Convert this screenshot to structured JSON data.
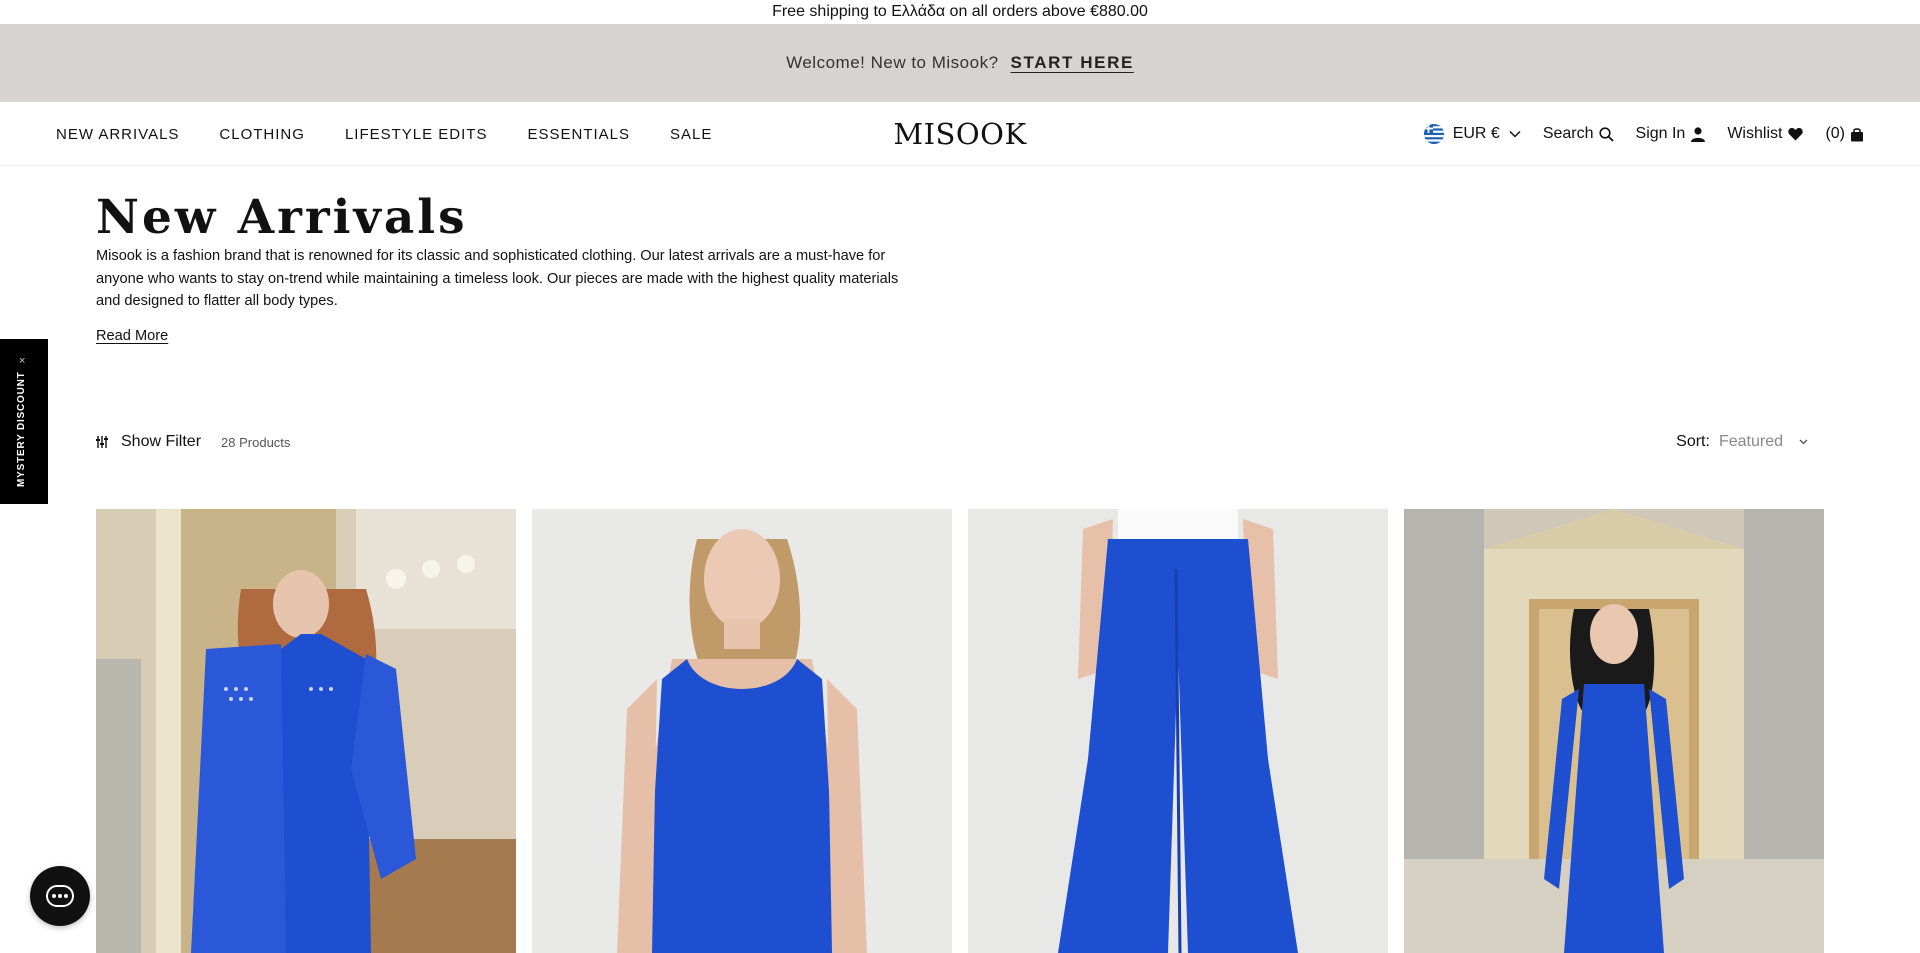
{
  "shipping_bar": {
    "text": "Free shipping to Ελλάδα on all orders above €880.00"
  },
  "welcome_bar": {
    "text": "Welcome! New to Misook?",
    "cta": "START HERE"
  },
  "header": {
    "nav": [
      "NEW ARRIVALS",
      "CLOTHING",
      "LIFESTYLE EDITS",
      "ESSENTIALS",
      "SALE"
    ],
    "logo": "MISOOK",
    "currency": "EUR €",
    "search": "Search",
    "sign_in": "Sign In",
    "wishlist": "Wishlist",
    "cart_count": "(0)"
  },
  "page": {
    "title": "New Arrivals",
    "intro": "Misook is a fashion brand that is renowned for its classic and sophisticated clothing. Our latest arrivals are a must-have for anyone who wants to stay on-trend while maintaining a timeless look. Our pieces are made with the highest quality materials and designed to flatter all body types.",
    "read_more": "Read More"
  },
  "mystery_tab": {
    "label": "MYSTERY DISCOUNT",
    "close": "×"
  },
  "toolbar": {
    "filter_label": "Show Filter",
    "product_count": "28 Products",
    "sort_label": "Sort:",
    "sort_value": "Featured"
  },
  "products": [
    {
      "image": "model-blue-cardigan-image"
    },
    {
      "image": "model-blue-tank-image"
    },
    {
      "image": "blue-wide-pants-image"
    },
    {
      "image": "model-blue-dress-image"
    }
  ],
  "colors": {
    "accent_blue": "#1f4fd1",
    "welcome_bg": "#d6d3d2"
  }
}
